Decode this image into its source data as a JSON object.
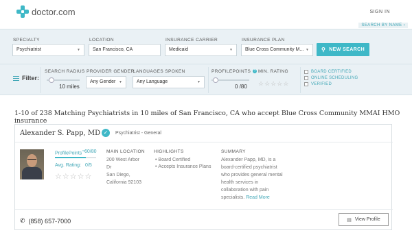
{
  "header": {
    "brand": "doctor.com",
    "sign_in": "SIGN IN",
    "search_by_name": "SEARCH BY NAME ›",
    "brand_color": "#3fb8c7"
  },
  "search": {
    "specialty_label": "SPECIALTY",
    "specialty_value": "Psychiatrist",
    "location_label": "LOCATION",
    "location_value": "San Francisco, CA",
    "carrier_label": "INSURANCE CARRIER",
    "carrier_value": "Medicaid",
    "plan_label": "INSURANCE PLAN",
    "plan_value": "Blue Cross Community M...",
    "new_search": "NEW SEARCH"
  },
  "filters": {
    "title": "Filter:",
    "radius_label": "SEARCH RADIUS",
    "radius_value": "10 miles",
    "gender_label": "PROVIDER GENDER",
    "gender_value": "Any Gender",
    "languages_label": "LANGUAGES SPOKEN",
    "languages_value": "Any Language",
    "profilepoints_label": "PROFILEPOINTS",
    "profilepoints_value": "0 /80",
    "min_rating_label": "MIN. RATING",
    "min_rating_value": 0,
    "checkbox_board": "BOARD CERTIFIED",
    "checkbox_online": "ONLINE SCHEDULING",
    "checkbox_verified": "VERIFIED"
  },
  "results": {
    "heading": "1-10 of 238 Matching Psychiatrists in 10 miles of San Francisco, CA who accept Blue Cross Community MMAI HMO insurance"
  },
  "doctor": {
    "name": "Alexander S. Papp, MD",
    "specialty": "Psychiatrist - General",
    "profilepoints_label": "ProfilePoints",
    "profilepoints_tm": "™",
    "profilepoints_score": "60/80",
    "profilepoints_fraction": 0.75,
    "avg_rating_label": "Avg. Rating:",
    "avg_rating_value": "0/5",
    "main_location_title": "MAIN LOCATION",
    "address_line1": "200 West Arbor",
    "address_line2": "Dr",
    "address_line3": "San Diego,",
    "address_line4": "California 92103",
    "highlights_title": "HIGHLIGHTS",
    "highlight_1": "Board Certified",
    "highlight_2": "Accepts Insurance Plans",
    "summary_title": "SUMMARY",
    "summary_line1": "Alexander Papp, MD, is a",
    "summary_line2": "board-certified psychiatrist",
    "summary_line3": "who provides general mental",
    "summary_line4": "health services in",
    "summary_line5": "collaboration with pain",
    "summary_line6": "specialists.",
    "read_more": "Read More",
    "phone": "(858) 657-7000",
    "view_profile": "View Profile"
  }
}
